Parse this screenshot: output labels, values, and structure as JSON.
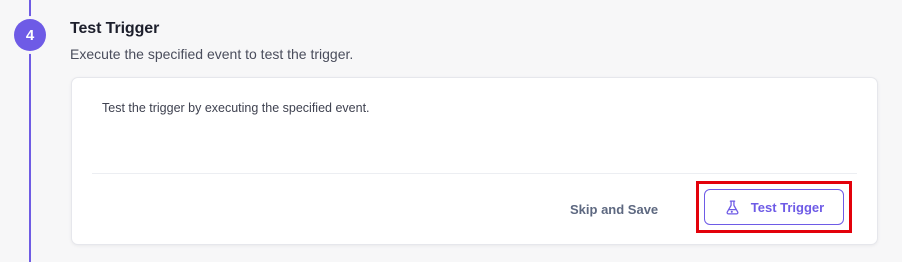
{
  "step": {
    "number": "4",
    "title": "Test Trigger",
    "subtitle": "Execute the specified event to test the trigger."
  },
  "card": {
    "description": "Test the trigger by executing the specified event.",
    "skip_label": "Skip and Save",
    "test_label": "Test Trigger",
    "test_icon": "flask-icon"
  },
  "colors": {
    "accent": "#6e5be6",
    "highlight": "#e3010b",
    "muted_button": "#5d6880"
  }
}
